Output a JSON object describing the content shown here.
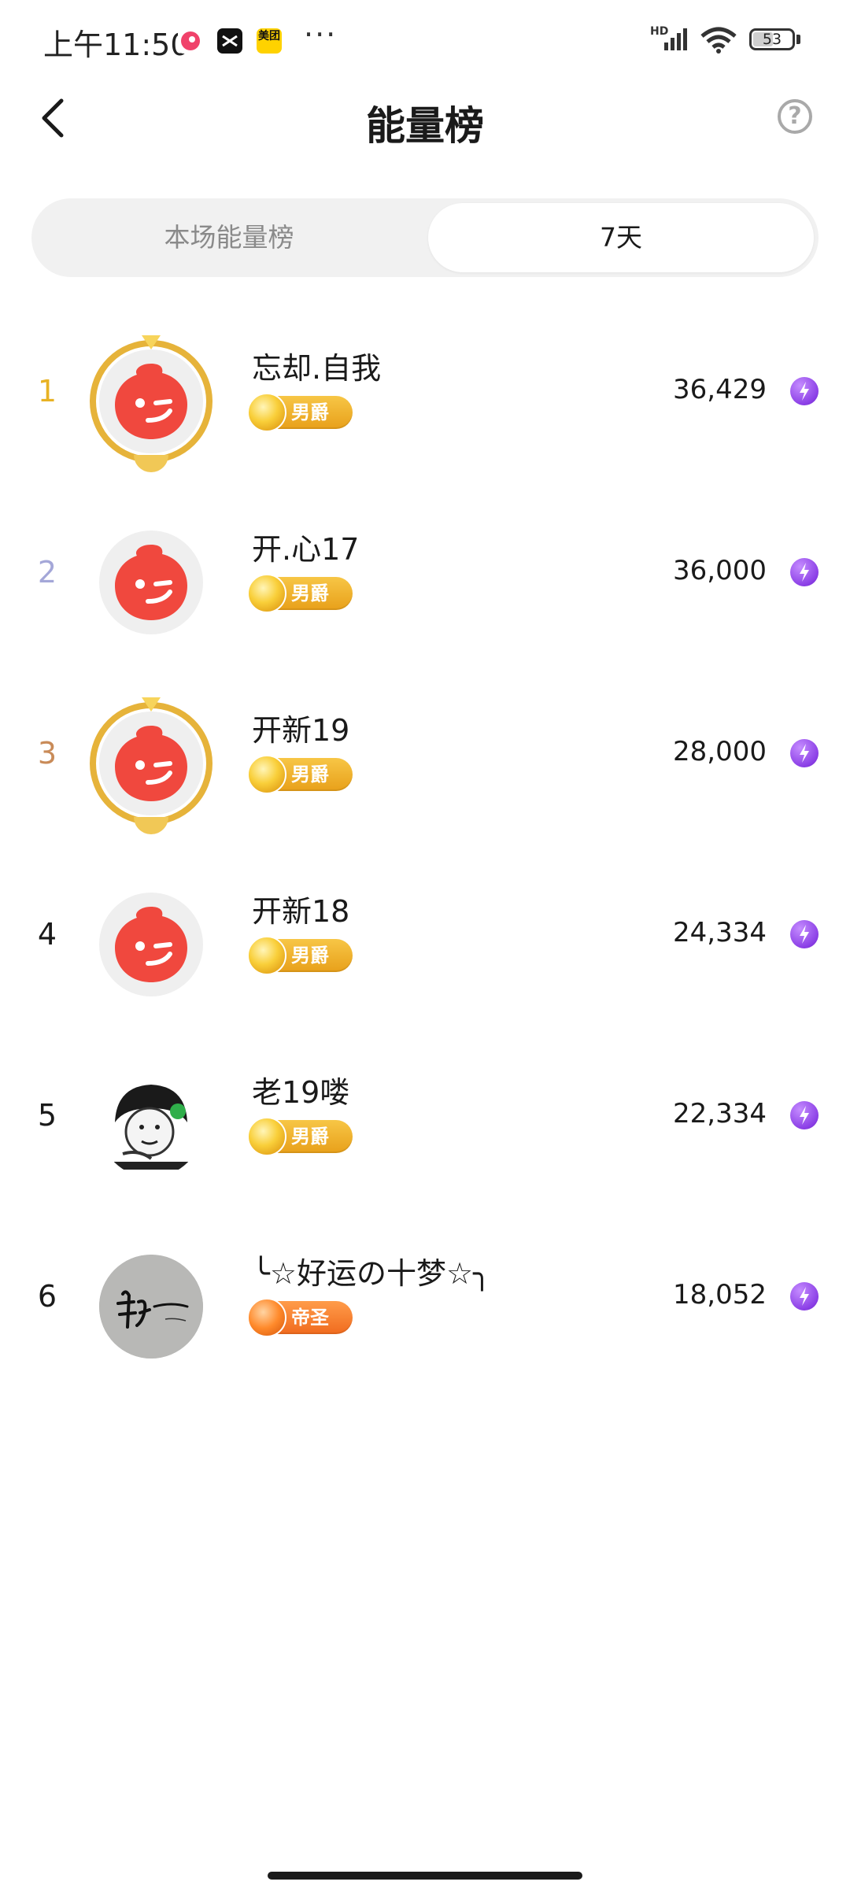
{
  "status_bar": {
    "time": "上午11:50",
    "app_icon_3_label": "美团",
    "more_dots": "···",
    "network_label": "HD",
    "battery_level": "53",
    "battery_percent": 53
  },
  "header": {
    "title": "能量榜",
    "help_symbol": "?"
  },
  "tabs": [
    {
      "label": "本场能量榜",
      "selected": false
    },
    {
      "label": "7天",
      "selected": true
    }
  ],
  "leaderboard": [
    {
      "rank": "1",
      "rank_color": "#e8b224",
      "name": "忘却.自我",
      "badge": "男爵",
      "badge_type": "baron",
      "energy": "36,429",
      "avatar": "red-mascot",
      "frame": "gold"
    },
    {
      "rank": "2",
      "rank_color": "#a4a7d8",
      "name": "开.心17",
      "badge": "男爵",
      "badge_type": "baron",
      "energy": "36,000",
      "avatar": "red-mascot",
      "frame": "none"
    },
    {
      "rank": "3",
      "rank_color": "#c98b58",
      "name": "开新19",
      "badge": "男爵",
      "badge_type": "baron",
      "energy": "28,000",
      "avatar": "red-mascot",
      "frame": "gold"
    },
    {
      "rank": "4",
      "rank_color": "#1a1a1a",
      "name": "开新18",
      "badge": "男爵",
      "badge_type": "baron",
      "energy": "24,334",
      "avatar": "red-mascot",
      "frame": "none"
    },
    {
      "rank": "5",
      "rank_color": "#1a1a1a",
      "name": "老19喽",
      "badge": "男爵",
      "badge_type": "baron",
      "energy": "22,334",
      "avatar": "meme-face",
      "frame": "none"
    },
    {
      "rank": "6",
      "rank_color": "#1a1a1a",
      "name": "╰☆好运の十梦☆╮",
      "badge": "帝圣",
      "badge_type": "emperor",
      "energy": "18,052",
      "avatar": "calligraphy",
      "frame": "none"
    }
  ],
  "colors": {
    "accent_gold": "#e8b224",
    "energy_bolt": "#8b3fe6",
    "mascot_red": "#f0483e",
    "tab_track": "#f1f1f1"
  }
}
